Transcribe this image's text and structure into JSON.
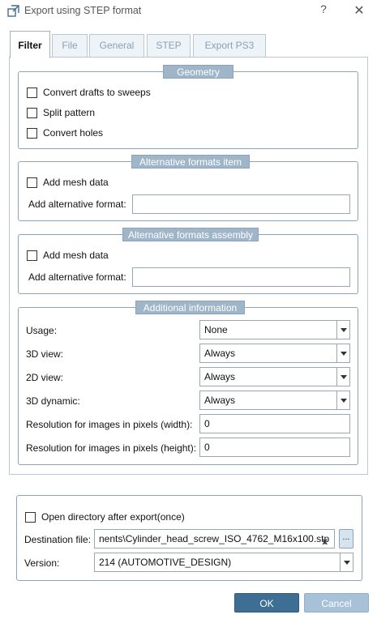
{
  "window": {
    "title": "Export using STEP format",
    "help_symbol": "?",
    "close_symbol": "✕",
    "icon": "export-step-icon"
  },
  "tabs": [
    {
      "label": "Filter",
      "active": true
    },
    {
      "label": "File",
      "active": false
    },
    {
      "label": "General",
      "active": false
    },
    {
      "label": "STEP",
      "active": false
    },
    {
      "label": "Export PS3",
      "active": false
    }
  ],
  "geometry": {
    "title": "Geometry",
    "convert_drafts": "Convert drafts to sweeps",
    "split_pattern": "Split pattern",
    "convert_holes": "Convert holes"
  },
  "alt_item": {
    "title": "Alternative formats item",
    "add_mesh": "Add mesh data",
    "alt_format_label": "Add alternative format:",
    "alt_format_value": ""
  },
  "alt_assembly": {
    "title": "Alternative formats assembly",
    "add_mesh": "Add mesh data",
    "alt_format_label": "Add alternative format:",
    "alt_format_value": ""
  },
  "additional": {
    "title": "Additional information",
    "usage_label": "Usage:",
    "usage_value": "None",
    "view3d_label": "3D view:",
    "view3d_value": "Always",
    "view2d_label": "2D view:",
    "view2d_value": "Always",
    "dynamic3d_label": "3D dynamic:",
    "dynamic3d_value": "Always",
    "res_width_label": "Resolution for images in pixels (width):",
    "res_width_value": "0",
    "res_height_label": "Resolution for images in pixels (height):",
    "res_height_value": "0"
  },
  "export": {
    "open_dir_label": "Open directory after export(once)",
    "dest_label": "Destination file:",
    "dest_value": "nents\\Cylinder_head_screw_ISO_4762_M16x100.stp",
    "clear_symbol": "x",
    "browse_label": "...",
    "version_label": "Version:",
    "version_value": "214 (AUTOMOTIVE_DESIGN)"
  },
  "buttons": {
    "ok": "OK",
    "cancel": "Cancel"
  },
  "colors": {
    "accent": "#3e6e93",
    "legend_bg": "#9fb5c8",
    "cancel_bg": "#a7c2d8"
  }
}
